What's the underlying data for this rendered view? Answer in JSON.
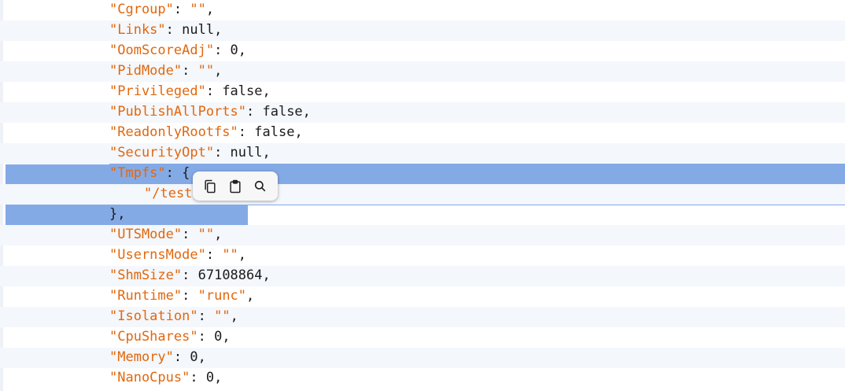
{
  "lines": [
    {
      "key": "\"Cgroup\"",
      "sep": ": ",
      "val": "\"\"",
      "valType": "str",
      "tail": ","
    },
    {
      "key": "\"Links\"",
      "sep": ": ",
      "val": "null",
      "valType": "plain",
      "tail": ","
    },
    {
      "key": "\"OomScoreAdj\"",
      "sep": ": ",
      "val": "0",
      "valType": "plain",
      "tail": ","
    },
    {
      "key": "\"PidMode\"",
      "sep": ": ",
      "val": "\"\"",
      "valType": "str",
      "tail": ","
    },
    {
      "key": "\"Privileged\"",
      "sep": ": ",
      "val": "false",
      "valType": "plain",
      "tail": ","
    },
    {
      "key": "\"PublishAllPorts\"",
      "sep": ": ",
      "val": "false",
      "valType": "plain",
      "tail": ","
    },
    {
      "key": "\"ReadonlyRootfs\"",
      "sep": ": ",
      "val": "false",
      "valType": "plain",
      "tail": ","
    },
    {
      "key": "\"SecurityOpt\"",
      "sep": ": ",
      "val": "null",
      "valType": "plain",
      "tail": ","
    },
    {
      "key": "\"Tmpfs\"",
      "sep": ": ",
      "val": "{",
      "valType": "plain",
      "tail": ""
    },
    {
      "key": "\"/test",
      "sep": "",
      "val": "",
      "valType": "plain",
      "tail": "",
      "indent": true
    },
    {
      "key": "",
      "sep": "",
      "val": "}",
      "valType": "plain",
      "tail": ","
    },
    {
      "key": "\"UTSMode\"",
      "sep": ": ",
      "val": "\"\"",
      "valType": "str",
      "tail": ","
    },
    {
      "key": "\"UsernsMode\"",
      "sep": ": ",
      "val": "\"\"",
      "valType": "str",
      "tail": ","
    },
    {
      "key": "\"ShmSize\"",
      "sep": ": ",
      "val": "67108864",
      "valType": "plain",
      "tail": ","
    },
    {
      "key": "\"Runtime\"",
      "sep": ": ",
      "val": "\"runc\"",
      "valType": "str",
      "tail": ","
    },
    {
      "key": "\"Isolation\"",
      "sep": ": ",
      "val": "\"\"",
      "valType": "str",
      "tail": ","
    },
    {
      "key": "\"CpuShares\"",
      "sep": ": ",
      "val": "0",
      "valType": "plain",
      "tail": ","
    },
    {
      "key": "\"Memory\"",
      "sep": ": ",
      "val": "0",
      "valType": "plain",
      "tail": ","
    },
    {
      "key": "\"NanoCpus\"",
      "sep": ": ",
      "val": "0",
      "valType": "plain",
      "tail": ","
    }
  ],
  "popup": {
    "icons": [
      "copy-icon",
      "paste-icon",
      "search-icon"
    ]
  },
  "colors": {
    "key": "#e2670d",
    "text": "#1b1b1b",
    "selection": "#84aae6",
    "stripe": "#f4f7fb"
  }
}
